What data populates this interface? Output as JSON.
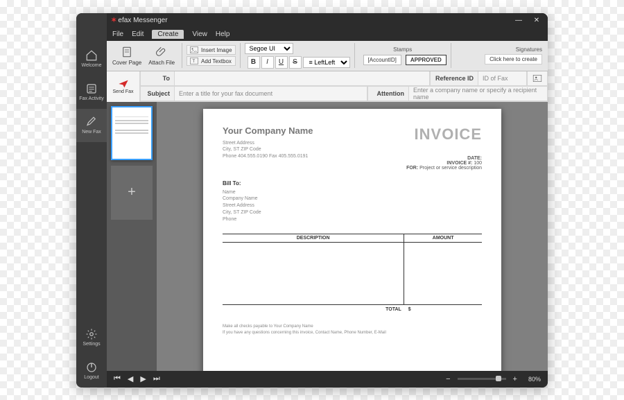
{
  "app": {
    "title": "efax Messenger"
  },
  "menu": {
    "file": "File",
    "edit": "Edit",
    "create": "Create",
    "view": "View",
    "help": "Help"
  },
  "windowControls": {
    "minimize": "—",
    "close": "✕"
  },
  "leftRail": {
    "welcome": "Welcome",
    "faxActivity": "Fax Activity",
    "newFax": "New Fax",
    "settings": "Settings",
    "logout": "Logout"
  },
  "ribbon": {
    "coverPage": "Cover Page",
    "attachFile": "Attach File",
    "insertImage": "Insert Image",
    "addTextbox": "Add Textbox",
    "fontName": "Segoe UI",
    "formatBold": "B",
    "formatItalic": "I",
    "formatUnderline": "U",
    "formatStrike": "S",
    "alignLeft": "Left",
    "stampsLabel": "Stamps",
    "stampAccountId": "[AccountID]",
    "stampApproved": "APPROVED",
    "signaturesLabel": "Signatures",
    "createSignature": "Click here to create"
  },
  "fields": {
    "sendFax": "Send Fax",
    "toLabel": "To",
    "toValue": "",
    "refLabel": "Reference ID",
    "refPlaceholder": "ID of Fax",
    "subjectLabel": "Subject",
    "subjectPlaceholder": "Enter a title for your fax document",
    "attentionLabel": "Attention",
    "attentionPlaceholder": "Enter a company name or specify a recipient name"
  },
  "thumbAdd": "+",
  "document": {
    "invoiceTitle": "INVOICE",
    "companyName": "Your Company Name",
    "address1": "Street Address",
    "address2": "City, ST  ZIP Code",
    "phoneLine": "Phone 404.555.0190   Fax 405.555.0191",
    "dateLabel": "DATE:",
    "invoiceNoLabel": "INVOICE #:",
    "invoiceNo": "100",
    "forLabel": "FOR:",
    "forText": "Project or service description",
    "billToLabel": "Bill To:",
    "billName": "Name",
    "billCompany": "Company Name",
    "billAddr1": "Street Address",
    "billAddr2": "City, ST  ZIP Code",
    "billPhone": "Phone",
    "colDescription": "DESCRIPTION",
    "colAmount": "AMOUNT",
    "totalLabel": "TOTAL",
    "totalValue": "$",
    "foot1": "Make all checks payable to Your Company Name",
    "foot2": "If you have any questions concerning this invoice, Contact Name, Phone Number, E-Mail"
  },
  "bottom": {
    "zoom": "80%"
  }
}
